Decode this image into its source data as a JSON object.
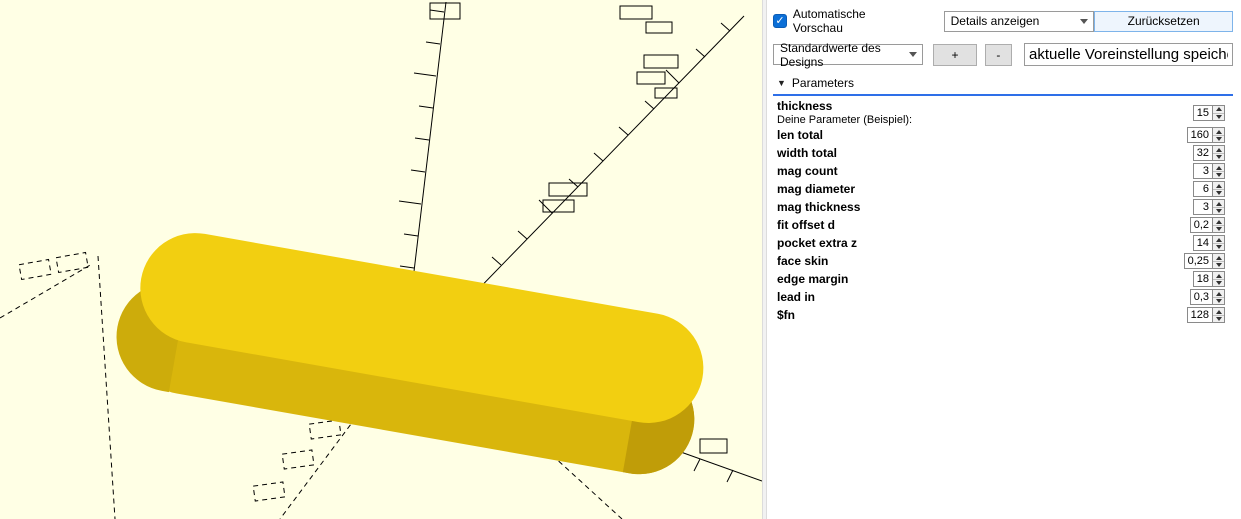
{
  "viewport": {
    "colors": {
      "background": "#FFFFE5",
      "object_top": "#F2CF11",
      "object_side": "#D9B60C",
      "object_side_right": "#C09D08",
      "object_side_left": "#CDAC0B"
    }
  },
  "customizer": {
    "auto_preview_label": "Automatische Vorschau",
    "details_dropdown_value": "Details anzeigen",
    "reset_button_label": "Zurücksetzen",
    "preset_dropdown_value": "Standardwerte des Designs",
    "add_button_label": "+",
    "remove_button_label": "-",
    "save_preset_value": "aktuelle Voreinstellung speichern",
    "parameters_header_label": "Parameters",
    "parameters": [
      {
        "label": "thickness",
        "description": "Deine Parameter (Beispiel):",
        "value": "15"
      },
      {
        "label": "len total",
        "value": "160"
      },
      {
        "label": "width total",
        "value": "32"
      },
      {
        "label": "mag count",
        "value": "3"
      },
      {
        "label": "mag diameter",
        "value": "6"
      },
      {
        "label": "mag thickness",
        "value": "3"
      },
      {
        "label": "fit offset d",
        "value": "0,2"
      },
      {
        "label": "pocket extra z",
        "value": "14"
      },
      {
        "label": "face skin",
        "value": "0,25"
      },
      {
        "label": "edge margin",
        "value": "18"
      },
      {
        "label": "lead in",
        "value": "0,3"
      },
      {
        "label": "$fn",
        "value": "128"
      }
    ]
  }
}
